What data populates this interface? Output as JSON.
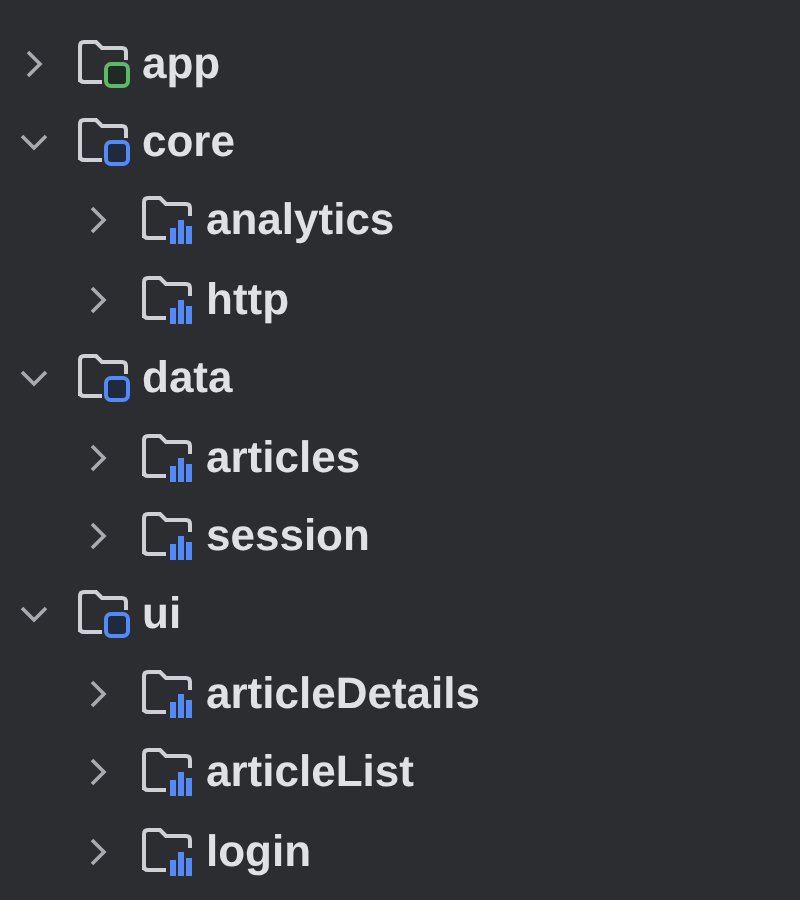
{
  "tree": [
    {
      "label": "app",
      "kind": "app-module",
      "expanded": false
    },
    {
      "label": "core",
      "kind": "module",
      "expanded": true,
      "children": [
        {
          "label": "analytics",
          "kind": "package",
          "expanded": false
        },
        {
          "label": "http",
          "kind": "package",
          "expanded": false
        }
      ]
    },
    {
      "label": "data",
      "kind": "module",
      "expanded": true,
      "children": [
        {
          "label": "articles",
          "kind": "package",
          "expanded": false
        },
        {
          "label": "session",
          "kind": "package",
          "expanded": false
        }
      ]
    },
    {
      "label": "ui",
      "kind": "module",
      "expanded": true,
      "children": [
        {
          "label": "articleDetails",
          "kind": "package",
          "expanded": false
        },
        {
          "label": "articleList",
          "kind": "package",
          "expanded": false
        },
        {
          "label": "login",
          "kind": "package",
          "expanded": false
        }
      ]
    }
  ]
}
